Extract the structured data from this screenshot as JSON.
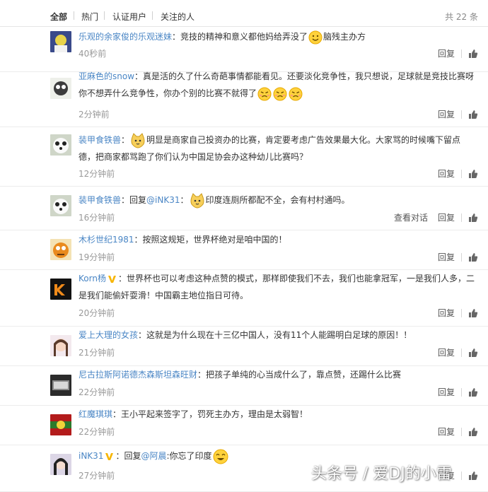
{
  "tabs": [
    "全部",
    "热门",
    "认证用户",
    "关注的人"
  ],
  "total_label": "共 22 条",
  "actions": {
    "reply": "回复",
    "view_conversation": "查看对话"
  },
  "colors": {
    "username": "#eb7350",
    "mention": "#4a86c5",
    "time": "#999999",
    "verified": "#f7b500"
  },
  "comments": [
    {
      "user": "乐观的余家俊的乐观迷妹",
      "user_color": "blue",
      "before": "：竞技的精神和意义都他妈给弄没了",
      "emoji": [
        "smile-emoji"
      ],
      "after": "脑残主办方",
      "time": "40秒前"
    },
    {
      "user": "亚麻色的snow",
      "user_color": "blue",
      "before": "：真是活的久了什么奇葩事情都能看见。还要淡化竞争性，我只想说，足球就是竞技比赛呀你不想弄什么竞争性，你办个别的比赛不就得了",
      "emoji": [
        "angry-emoji",
        "angry-emoji",
        "angry-emoji"
      ],
      "after": "",
      "time": "2分钟前"
    },
    {
      "user": "装甲食铁兽",
      "user_color": "blue",
      "before": "：",
      "emoji": [
        "cat-emoji"
      ],
      "after": "明显是商家自己投资办的比赛，肯定要考虑广告效果最大化。大家骂的时候嘴下留点德，把商家都骂跑了你们认为中国足协会办这种幼儿比赛吗？",
      "time": "12分钟前"
    },
    {
      "user": "装甲食铁兽",
      "user_color": "blue",
      "before": "：回复",
      "mention": "@iNK31",
      "mention_suffix": "：",
      "emoji": [
        "cat-emoji"
      ],
      "after": "印度连厕所都配不全，会有村村通吗。",
      "time": "16分钟前",
      "view_conversation": true
    },
    {
      "user": "木杉世纪1981",
      "user_color": "blue",
      "before": "：按照这规矩，世界杯绝对是咱中国的！",
      "emoji": [],
      "after": "",
      "time": "19分钟前"
    },
    {
      "user": "Korn杨",
      "user_color": "blue",
      "verified": true,
      "before": "：世界杯也可以考虑这种点赞的模式，那样即使我们不去，我们也能拿冠军，一是我们人多，二是我们能偷奸耍滑！中国霸主地位指日可待。",
      "emoji": [],
      "after": "",
      "time": "20分钟前"
    },
    {
      "user": "爱上大理的女孩",
      "user_color": "blue",
      "before": "：这就是为什么现在十三亿中国人，没有11个人能踢明白足球的原因！！",
      "emoji": [],
      "after": "",
      "time": "21分钟前"
    },
    {
      "user": "尼古拉斯阿诺德杰森斯坦森旺财",
      "user_color": "blue",
      "before": "：把孩子单纯的心当成什么了，靠点赞，还踢什么比赛",
      "emoji": [],
      "after": "",
      "time": "22分钟前"
    },
    {
      "user": "红魔琪琪",
      "user_color": "blue",
      "before": "：王小平起来签字了，罚死主办方，理由是太弱智！",
      "emoji": [],
      "after": "",
      "time": "22分钟前"
    },
    {
      "user": "iNK31",
      "user_color": "blue",
      "verified": true,
      "before": "：回复",
      "mention": "@阿晨",
      "mention_suffix": ":你忘了印度",
      "emoji": [
        "laugh-emoji"
      ],
      "after": "",
      "time": "27分钟前"
    }
  ],
  "watermark": "头条号 / 爱DJ的小雷"
}
